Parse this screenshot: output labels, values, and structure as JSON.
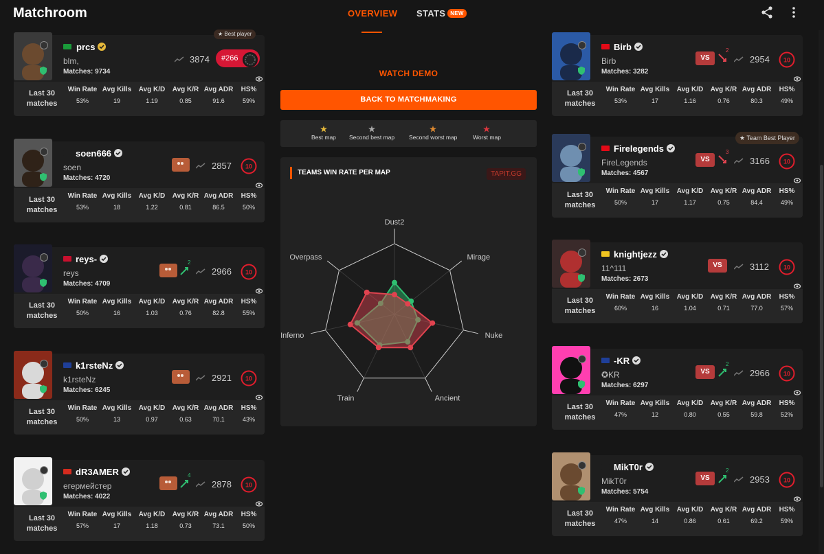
{
  "app": {
    "title": "Matchroom",
    "tabs": [
      {
        "label": "OVERVIEW"
      },
      {
        "label": "STATS",
        "badge": "NEW"
      }
    ]
  },
  "center": {
    "watch_demo": "WATCH DEMO",
    "back_button": "BACK TO MATCHMAKING",
    "legend": [
      "Best map",
      "Second best map",
      "Second worst map",
      "Worst map"
    ],
    "radar_title": "TEAMS WIN RATE PER MAP",
    "radar_source": "TAPIT.GG",
    "maps": [
      "Dust2",
      "Mirage",
      "Nuke",
      "Ancient",
      "Train",
      "Inferno",
      "Overpass"
    ]
  },
  "stat_headers": [
    "Win Rate",
    "Avg Kills",
    "Avg K/D",
    "Avg K/R",
    "Avg ADR",
    "HS%"
  ],
  "last30_label": "Last 30 matches",
  "best_player_label": "Best player",
  "team_best_label": "Team Best Player",
  "left_team": [
    {
      "name": "prcs",
      "nick": "blm,",
      "matches": "Matches: 9734",
      "elo": "3874",
      "rank": "#266",
      "stats": [
        "53%",
        "19",
        "1.19",
        "0.85",
        "91.6",
        "59%"
      ]
    },
    {
      "name": "soen666",
      "nick": "soen",
      "matches": "Matches: 4720",
      "elo": "2857",
      "stats": [
        "53%",
        "18",
        "1.22",
        "0.81",
        "86.5",
        "50%"
      ]
    },
    {
      "name": "reys-",
      "nick": "reys",
      "matches": "Matches: 4709",
      "elo": "2966",
      "streak": "2",
      "stats": [
        "50%",
        "16",
        "1.03",
        "0.76",
        "82.8",
        "55%"
      ]
    },
    {
      "name": "k1rsteNz",
      "nick": "k1rsteNz",
      "matches": "Matches: 6245",
      "elo": "2921",
      "stats": [
        "50%",
        "13",
        "0.97",
        "0.63",
        "70.1",
        "43%"
      ]
    },
    {
      "name": "dR3AMER",
      "nick": "егермейстер",
      "matches": "Matches: 4022",
      "elo": "2878",
      "streak": "4",
      "stats": [
        "57%",
        "17",
        "1.18",
        "0.73",
        "73.1",
        "50%"
      ]
    }
  ],
  "right_team": [
    {
      "name": "Birb",
      "nick": "Birb",
      "matches": "Matches: 3282",
      "elo": "2954",
      "vs": "VS",
      "streak": "2",
      "stats": [
        "53%",
        "17",
        "1.16",
        "0.76",
        "80.3",
        "49%"
      ]
    },
    {
      "name": "Firelegends",
      "nick": "FireLegends",
      "matches": "Matches: 4567",
      "elo": "3166",
      "vs": "VS",
      "streak": "3",
      "stats": [
        "50%",
        "17",
        "1.17",
        "0.75",
        "84.4",
        "49%"
      ]
    },
    {
      "name": "knightjezz",
      "nick": "11^111",
      "matches": "Matches: 2673",
      "elo": "3112",
      "vs": "VS",
      "stats": [
        "60%",
        "16",
        "1.04",
        "0.71",
        "77.0",
        "57%"
      ]
    },
    {
      "name": "-KR",
      "nick": "✪KR",
      "matches": "Matches: 6297",
      "elo": "2966",
      "vs": "VS",
      "streak": "2",
      "stats": [
        "47%",
        "12",
        "0.80",
        "0.55",
        "59.8",
        "52%"
      ]
    },
    {
      "name": "MikT0r",
      "nick": "MikT0r",
      "matches": "Matches: 5754",
      "elo": "2953",
      "vs": "VS",
      "streak": "2",
      "stats": [
        "47%",
        "14",
        "0.86",
        "0.61",
        "69.2",
        "59%"
      ]
    }
  ],
  "radar_data": {
    "red_team": [
      0.28,
      0.24,
      0.55,
      0.52,
      0.52,
      0.64,
      0.5
    ],
    "green_team": [
      0.45,
      0.3,
      0.34,
      0.43,
      0.48,
      0.54,
      0.25
    ]
  },
  "colors": {
    "accent": "#ff5500",
    "red_team": "#e0434f",
    "green_team": "#2fbf71",
    "level_ring": "#e11d2c"
  }
}
